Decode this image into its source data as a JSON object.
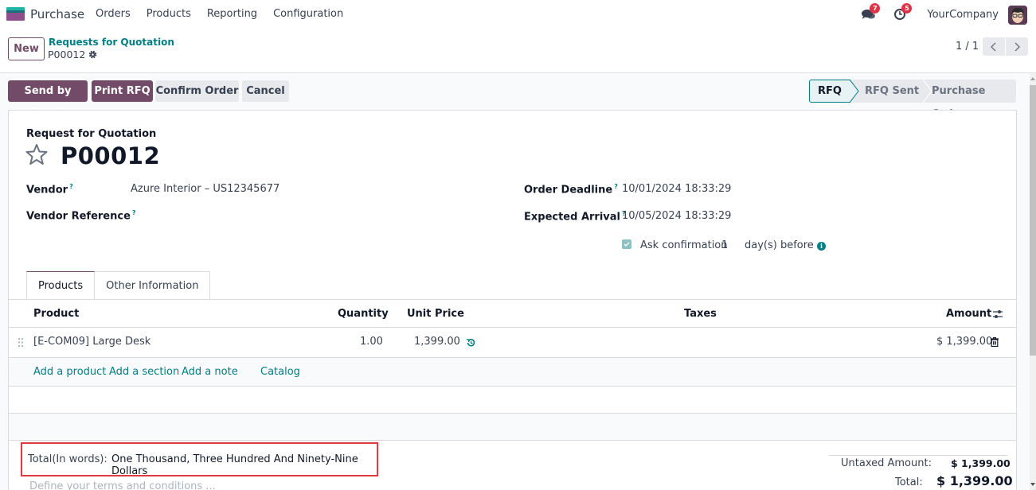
{
  "navbar": {
    "app_name": "Purchase",
    "menu": [
      "Orders",
      "Products",
      "Reporting",
      "Configuration"
    ],
    "messages_count": "7",
    "activities_count": "5",
    "company": "YourCompany",
    "icons": {
      "messages": "chat-bubbles-icon",
      "activities": "clock-icon",
      "avatar": "user-avatar"
    }
  },
  "control_panel": {
    "new_label": "New",
    "breadcrumb_parent": "Requests for Quotation",
    "breadcrumb_current": "P00012",
    "pager": "1 / 1"
  },
  "actions": {
    "send_email": "Send by Email",
    "print_rfq": "Print RFQ",
    "confirm_order": "Confirm Order",
    "cancel": "Cancel"
  },
  "statusbar": {
    "stages": [
      "RFQ",
      "RFQ Sent",
      "Purchase Order"
    ],
    "active": "RFQ"
  },
  "form": {
    "subtitle": "Request for Quotation",
    "title": "P00012",
    "vendor_label": "Vendor",
    "vendor_value": "Azure Interior – US12345677",
    "vendor_ref_label": "Vendor Reference",
    "vendor_ref_value": "",
    "order_deadline_label": "Order Deadline",
    "order_deadline_value": "10/01/2024 18:33:29",
    "expected_arrival_label": "Expected Arrival",
    "expected_arrival_value": "10/05/2024 18:33:29",
    "ask_confirmation_label": "Ask confirmation",
    "ask_confirmation_checked": true,
    "ask_confirmation_days": "1",
    "days_before_label": "day(s) before",
    "help_mark": "?"
  },
  "tabs": [
    "Products",
    "Other Information"
  ],
  "table": {
    "headers": {
      "product": "Product",
      "quantity": "Quantity",
      "unit_price": "Unit Price",
      "taxes": "Taxes",
      "amount": "Amount"
    },
    "rows": [
      {
        "product": "[E-COM09] Large Desk",
        "quantity": "1.00",
        "unit_price": "1,399.00",
        "taxes": "",
        "amount": "$ 1,399.00"
      }
    ],
    "add_links": [
      "Add a product",
      "Add a section",
      "Add a note",
      "Catalog"
    ]
  },
  "footer": {
    "words_label": "Total(In words):",
    "words_value": "One Thousand, Three Hundred And Ninety-Nine Dollars",
    "terms_placeholder": "Define your terms and conditions ...",
    "untaxed_label": "Untaxed Amount:",
    "untaxed_value": "$ 1,399.00",
    "total_label": "Total:",
    "total_value": "$ 1,399.00"
  },
  "colors": {
    "brand": "#714b67",
    "accent": "#017e84",
    "highlight_box": "#e0393e"
  }
}
